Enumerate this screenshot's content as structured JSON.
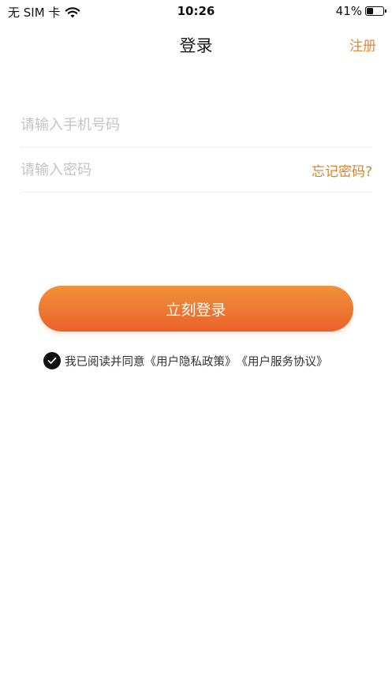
{
  "status_bar": {
    "carrier": "无 SIM 卡",
    "time": "10:26",
    "battery_percent": "41%",
    "battery_level": 0.41
  },
  "nav": {
    "title": "登录",
    "register": "注册"
  },
  "form": {
    "phone_placeholder": "请输入手机号码",
    "password_placeholder": "请输入密码",
    "forgot_password": "忘记密码?"
  },
  "login_button": "立刻登录",
  "agreement": {
    "text": "我已阅读并同意",
    "privacy_policy": "《用户隐私政策》",
    "service_agreement": "《用户服务协议》",
    "checked": true
  },
  "colors": {
    "accent": "#e98838",
    "button_gradient_top": "#f19139",
    "button_gradient_bottom": "#ea622b",
    "placeholder": "#c4c4c4"
  }
}
